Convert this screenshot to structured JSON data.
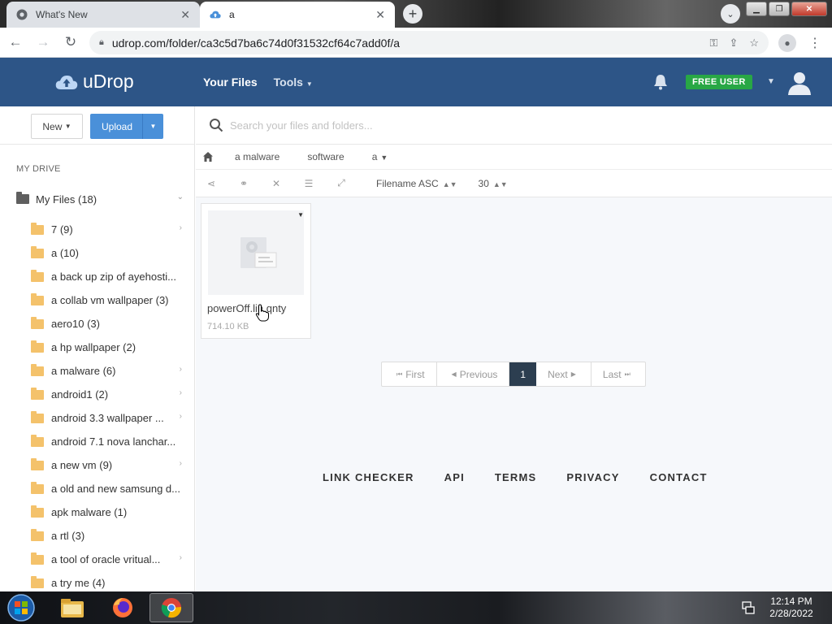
{
  "browser": {
    "tabs": [
      {
        "title": "What's New",
        "active": false
      },
      {
        "title": "a",
        "active": true
      }
    ],
    "new_tab_symbol": "+",
    "url": "udrop.com/folder/ca3c5d7ba6c74d0f31532cf64c7add0f/a"
  },
  "header": {
    "logo_text": "uDrop",
    "nav": [
      "Your Files",
      "Tools"
    ],
    "badge": "FREE USER",
    "brand_color": "#2d5587",
    "badge_color": "#28a745"
  },
  "sidebar": {
    "new_label": "New",
    "upload_label": "Upload",
    "drive_title": "MY DRIVE",
    "root": "My Files (18)",
    "items": [
      {
        "label": "7 (9)",
        "expandable": true
      },
      {
        "label": "a (10)",
        "expandable": false
      },
      {
        "label": "a back up zip of ayehosti...",
        "expandable": false
      },
      {
        "label": "a collab vm wallpaper (3)",
        "expandable": false
      },
      {
        "label": "aero10 (3)",
        "expandable": false
      },
      {
        "label": "a hp wallpaper (2)",
        "expandable": false
      },
      {
        "label": "a malware (6)",
        "expandable": true
      },
      {
        "label": "android1 (2)",
        "expandable": true
      },
      {
        "label": "android 3.3 wallpaper ...",
        "expandable": true
      },
      {
        "label": "android 7.1 nova lanchar...",
        "expandable": false
      },
      {
        "label": "a new vm (9)",
        "expandable": true
      },
      {
        "label": "a old and new samsung d...",
        "expandable": false
      },
      {
        "label": "apk malware (1)",
        "expandable": false
      },
      {
        "label": "a rtl (3)",
        "expandable": false
      },
      {
        "label": "a tool of oracle vritual...",
        "expandable": true
      },
      {
        "label": "a try me (4)",
        "expandable": false
      }
    ]
  },
  "main": {
    "search_placeholder": "Search your files and folders...",
    "breadcrumbs": [
      "a malware",
      "software",
      "a"
    ],
    "sort_label": "Filename ASC",
    "per_page": "30",
    "file": {
      "name": "powerOff.lin.qnty",
      "size": "714.10 KB"
    },
    "pagination": {
      "first": "First",
      "previous": "Previous",
      "current": "1",
      "next": "Next",
      "last": "Last"
    }
  },
  "footer": [
    "LINK CHECKER",
    "API",
    "TERMS",
    "PRIVACY",
    "CONTACT"
  ],
  "taskbar": {
    "time": "12:14 PM",
    "date": "2/28/2022"
  }
}
